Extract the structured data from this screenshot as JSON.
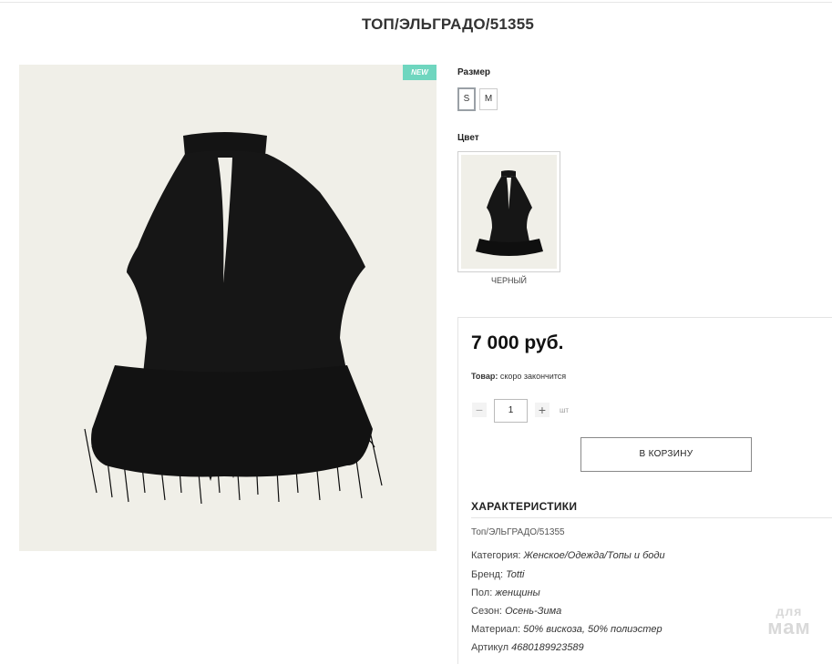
{
  "product": {
    "title": "ТОП/ЭЛЬГРАДО/51355",
    "badge": "NEW",
    "size_label": "Размер",
    "sizes": [
      "S",
      "M"
    ],
    "selected_size": "S",
    "color_label": "Цвет",
    "color_name": "ЧЕРНЫЙ",
    "price": "7 000 руб.",
    "stock_label": "Товар:",
    "stock_value": "скоро закончится",
    "quantity": "1",
    "quantity_unit": "шт",
    "qty_minus": "−",
    "qty_plus": "+",
    "cart_button": "В КОРЗИНУ"
  },
  "specs": {
    "title": "ХАРАКТЕРИСТИКИ",
    "sku_line": "Топ/ЭЛЬГРАДО/51355",
    "rows": [
      {
        "label": "Категория:",
        "value": "Женское/Одежда/Топы и боди"
      },
      {
        "label": "Бренд:",
        "value": "Totti"
      },
      {
        "label": "Пол:",
        "value": "женщины"
      },
      {
        "label": "Сезон:",
        "value": "Осень-Зима"
      },
      {
        "label": "Материал:",
        "value": "50% вискоза, 50% полиэстер"
      },
      {
        "label": "Артикул",
        "value": "4680189923589"
      }
    ]
  },
  "watermark": {
    "line1": "для",
    "line2": "мам"
  },
  "colors": {
    "badge": "#6fd6bf",
    "photo_bg": "#f0efe8",
    "garment": "#111111"
  }
}
